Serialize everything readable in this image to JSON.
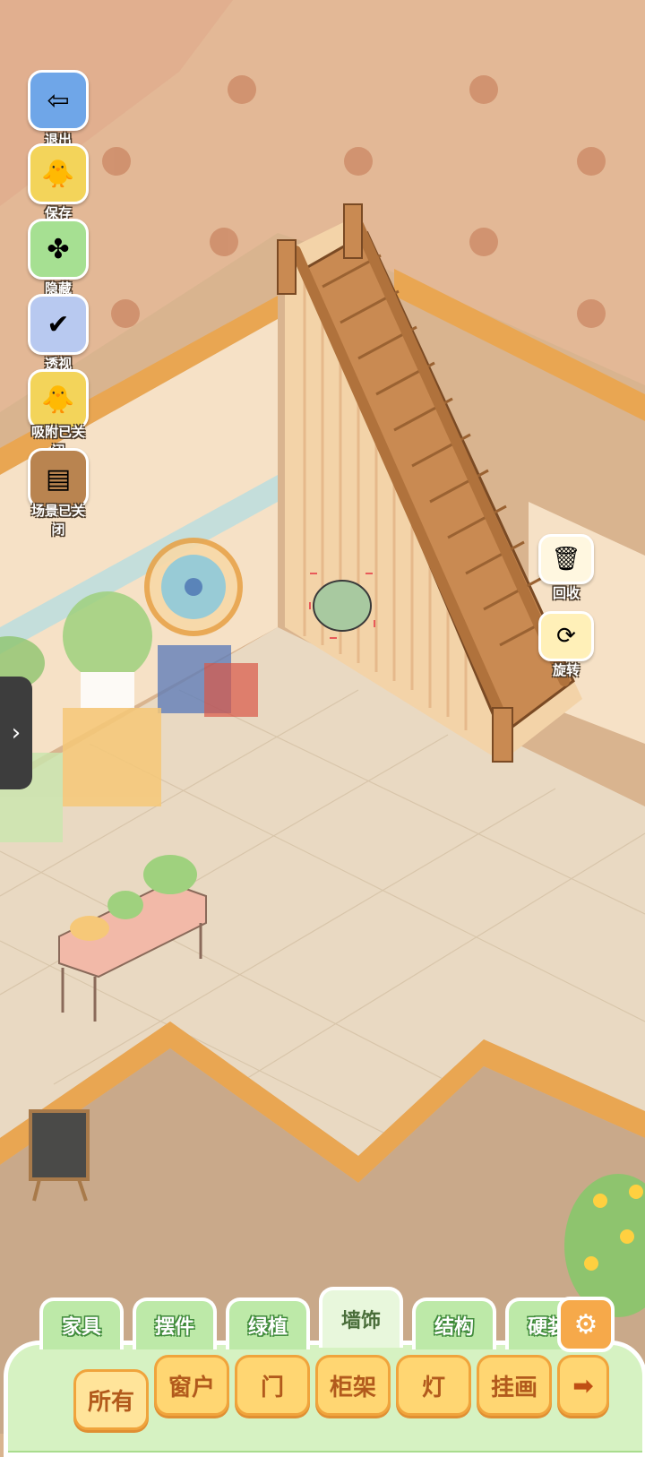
{
  "side_menu": [
    {
      "key": "exit",
      "label": "退出",
      "icon": "exit-icon",
      "color": "#6fa6e8"
    },
    {
      "key": "save",
      "label": "保存",
      "icon": "duck-save-icon",
      "color": "#f3d45a"
    },
    {
      "key": "hide",
      "label": "隐藏",
      "icon": "hide-icon",
      "color": "#a6e092"
    },
    {
      "key": "perspective",
      "label": "透视",
      "icon": "perspective-cube-icon",
      "color": "#b8c9f0"
    },
    {
      "key": "snap",
      "label": "吸附已关闭",
      "icon": "twin-ducks-icon",
      "color": "#f3d45a"
    },
    {
      "key": "scene",
      "label": "场景已关闭",
      "icon": "scene-board-icon",
      "color": "#b98450"
    }
  ],
  "actions": [
    {
      "key": "recycle",
      "label": "回收",
      "icon": "recycle-icon"
    },
    {
      "key": "rotate",
      "label": "旋转",
      "icon": "rotate-icon"
    }
  ],
  "drawer_handle": "›",
  "tabs": [
    {
      "label": "家具",
      "active": false
    },
    {
      "label": "摆件",
      "active": false
    },
    {
      "label": "绿植",
      "active": false
    },
    {
      "label": "墙饰",
      "active": true
    },
    {
      "label": "结构",
      "active": false
    },
    {
      "label": "硬装",
      "active": false
    }
  ],
  "settings_icon": "gear-icon",
  "subcategories": [
    {
      "label": "所有",
      "active": true
    },
    {
      "label": "窗户",
      "active": false
    },
    {
      "label": "门",
      "active": false
    },
    {
      "label": "柜架",
      "active": false
    },
    {
      "label": "灯",
      "active": false
    },
    {
      "label": "挂画",
      "active": false
    }
  ],
  "next_arrow": "➡",
  "colors": {
    "upper_floor": "#e3b896",
    "floor_tile": "#e9d9c2",
    "wall_cream": "#f6e1c6",
    "stair_wood": "#c98a52",
    "panel_green": "#d6f2c2",
    "accent_orange": "#ffd672"
  }
}
